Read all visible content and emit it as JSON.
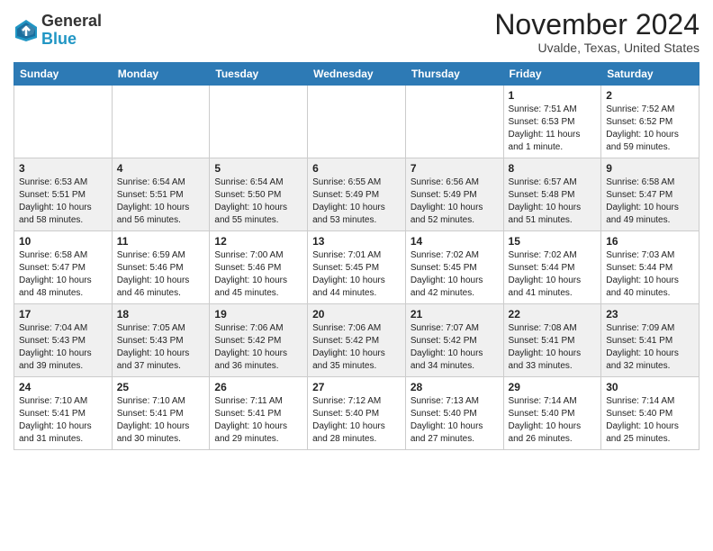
{
  "header": {
    "logo_line1": "General",
    "logo_line2": "Blue",
    "month": "November 2024",
    "location": "Uvalde, Texas, United States"
  },
  "weekdays": [
    "Sunday",
    "Monday",
    "Tuesday",
    "Wednesday",
    "Thursday",
    "Friday",
    "Saturday"
  ],
  "weeks": [
    [
      {
        "day": "",
        "info": ""
      },
      {
        "day": "",
        "info": ""
      },
      {
        "day": "",
        "info": ""
      },
      {
        "day": "",
        "info": ""
      },
      {
        "day": "",
        "info": ""
      },
      {
        "day": "1",
        "info": "Sunrise: 7:51 AM\nSunset: 6:53 PM\nDaylight: 11 hours\nand 1 minute."
      },
      {
        "day": "2",
        "info": "Sunrise: 7:52 AM\nSunset: 6:52 PM\nDaylight: 10 hours\nand 59 minutes."
      }
    ],
    [
      {
        "day": "3",
        "info": "Sunrise: 6:53 AM\nSunset: 5:51 PM\nDaylight: 10 hours\nand 58 minutes."
      },
      {
        "day": "4",
        "info": "Sunrise: 6:54 AM\nSunset: 5:51 PM\nDaylight: 10 hours\nand 56 minutes."
      },
      {
        "day": "5",
        "info": "Sunrise: 6:54 AM\nSunset: 5:50 PM\nDaylight: 10 hours\nand 55 minutes."
      },
      {
        "day": "6",
        "info": "Sunrise: 6:55 AM\nSunset: 5:49 PM\nDaylight: 10 hours\nand 53 minutes."
      },
      {
        "day": "7",
        "info": "Sunrise: 6:56 AM\nSunset: 5:49 PM\nDaylight: 10 hours\nand 52 minutes."
      },
      {
        "day": "8",
        "info": "Sunrise: 6:57 AM\nSunset: 5:48 PM\nDaylight: 10 hours\nand 51 minutes."
      },
      {
        "day": "9",
        "info": "Sunrise: 6:58 AM\nSunset: 5:47 PM\nDaylight: 10 hours\nand 49 minutes."
      }
    ],
    [
      {
        "day": "10",
        "info": "Sunrise: 6:58 AM\nSunset: 5:47 PM\nDaylight: 10 hours\nand 48 minutes."
      },
      {
        "day": "11",
        "info": "Sunrise: 6:59 AM\nSunset: 5:46 PM\nDaylight: 10 hours\nand 46 minutes."
      },
      {
        "day": "12",
        "info": "Sunrise: 7:00 AM\nSunset: 5:46 PM\nDaylight: 10 hours\nand 45 minutes."
      },
      {
        "day": "13",
        "info": "Sunrise: 7:01 AM\nSunset: 5:45 PM\nDaylight: 10 hours\nand 44 minutes."
      },
      {
        "day": "14",
        "info": "Sunrise: 7:02 AM\nSunset: 5:45 PM\nDaylight: 10 hours\nand 42 minutes."
      },
      {
        "day": "15",
        "info": "Sunrise: 7:02 AM\nSunset: 5:44 PM\nDaylight: 10 hours\nand 41 minutes."
      },
      {
        "day": "16",
        "info": "Sunrise: 7:03 AM\nSunset: 5:44 PM\nDaylight: 10 hours\nand 40 minutes."
      }
    ],
    [
      {
        "day": "17",
        "info": "Sunrise: 7:04 AM\nSunset: 5:43 PM\nDaylight: 10 hours\nand 39 minutes."
      },
      {
        "day": "18",
        "info": "Sunrise: 7:05 AM\nSunset: 5:43 PM\nDaylight: 10 hours\nand 37 minutes."
      },
      {
        "day": "19",
        "info": "Sunrise: 7:06 AM\nSunset: 5:42 PM\nDaylight: 10 hours\nand 36 minutes."
      },
      {
        "day": "20",
        "info": "Sunrise: 7:06 AM\nSunset: 5:42 PM\nDaylight: 10 hours\nand 35 minutes."
      },
      {
        "day": "21",
        "info": "Sunrise: 7:07 AM\nSunset: 5:42 PM\nDaylight: 10 hours\nand 34 minutes."
      },
      {
        "day": "22",
        "info": "Sunrise: 7:08 AM\nSunset: 5:41 PM\nDaylight: 10 hours\nand 33 minutes."
      },
      {
        "day": "23",
        "info": "Sunrise: 7:09 AM\nSunset: 5:41 PM\nDaylight: 10 hours\nand 32 minutes."
      }
    ],
    [
      {
        "day": "24",
        "info": "Sunrise: 7:10 AM\nSunset: 5:41 PM\nDaylight: 10 hours\nand 31 minutes."
      },
      {
        "day": "25",
        "info": "Sunrise: 7:10 AM\nSunset: 5:41 PM\nDaylight: 10 hours\nand 30 minutes."
      },
      {
        "day": "26",
        "info": "Sunrise: 7:11 AM\nSunset: 5:41 PM\nDaylight: 10 hours\nand 29 minutes."
      },
      {
        "day": "27",
        "info": "Sunrise: 7:12 AM\nSunset: 5:40 PM\nDaylight: 10 hours\nand 28 minutes."
      },
      {
        "day": "28",
        "info": "Sunrise: 7:13 AM\nSunset: 5:40 PM\nDaylight: 10 hours\nand 27 minutes."
      },
      {
        "day": "29",
        "info": "Sunrise: 7:14 AM\nSunset: 5:40 PM\nDaylight: 10 hours\nand 26 minutes."
      },
      {
        "day": "30",
        "info": "Sunrise: 7:14 AM\nSunset: 5:40 PM\nDaylight: 10 hours\nand 25 minutes."
      }
    ]
  ]
}
